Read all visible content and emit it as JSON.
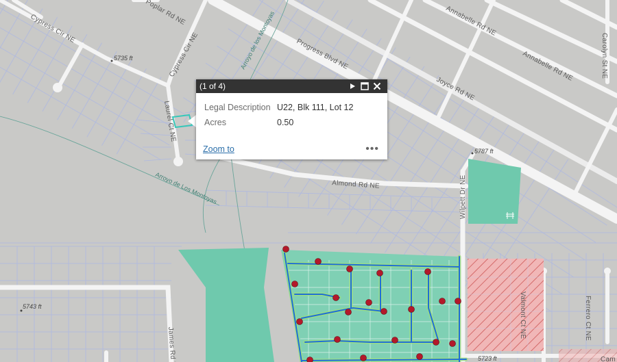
{
  "map": {
    "roads": {
      "cypress_cir_ne_1": "Cypress Cir NE",
      "cypress_cir_ne_2": "Cypress Cir NE",
      "poplar_rd_ne": "Poplar Rd NE",
      "progress_blvd_ne": "Progress Blvd NE",
      "annabelle_rd_ne_1": "Annabelle Rd NE",
      "annabelle_rd_ne_2": "Annabelle Rd NE",
      "carolyn_st_ne": "Carolyn St NE",
      "joyce_rd_ne": "Joyce Rd NE",
      "laurel_ct_ne": "Laurel Ct NE",
      "almond_rd_ne": "Almond Rd NE",
      "wilpett_dr_ne": "Wilpett Dr NE",
      "valmont_ct_ne": "Valmont Ct NE",
      "ferrero_ct_ne": "Ferrero Ct NE",
      "james_rd_ne": "James Rd NE",
      "cam": "Cam"
    },
    "arroyo_labels": {
      "top": "Arroyo de los Montoyas",
      "mid": "Arroyo de Los Montoyas"
    },
    "elevations": {
      "e1": "5735 ft",
      "e2": "5787 ft",
      "e3": "5743 ft",
      "e4": "5723 ft"
    },
    "colors": {
      "base": "#c9c9c7",
      "road": "#f4f4f4",
      "parcel_line": "#a9b5e6",
      "park_fill": "#6fc9ad",
      "hatch_fill": "#f1b7b7",
      "hatch_line": "#d46b6b",
      "pipe": "#1f6fd6",
      "pipe_glow": "#9fe07d",
      "marker": "#b3192a",
      "selected_outline": "#36c7b9"
    }
  },
  "popup": {
    "header": "(1 of 4)",
    "fields": [
      {
        "label": "Legal Description",
        "value": "U22, Blk 111, Lot 12"
      },
      {
        "label": "Acres",
        "value": "0.50"
      }
    ],
    "zoom_link": "Zoom to",
    "more": "•••"
  }
}
